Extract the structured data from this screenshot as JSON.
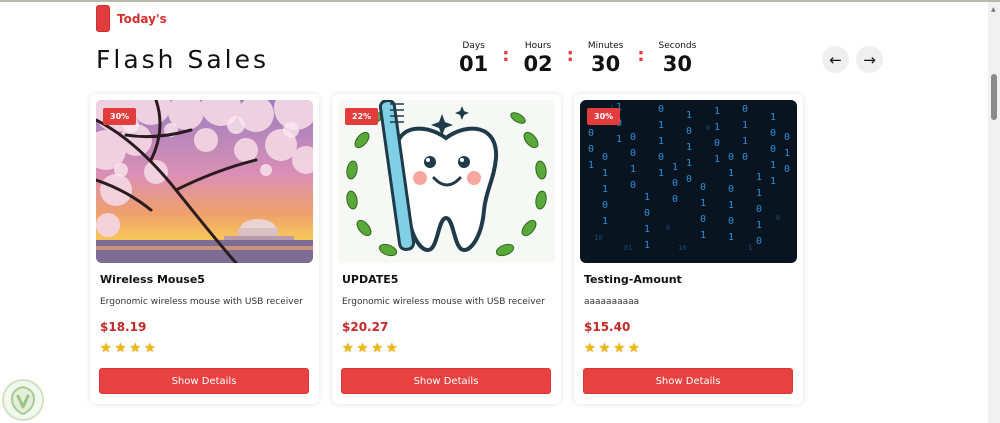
{
  "section": {
    "tag": "Today's",
    "title": "Flash Sales",
    "accent_color": "#e23c3c"
  },
  "countdown": {
    "days_label": "Days",
    "days": "01",
    "hours_label": "Hours",
    "hours": "02",
    "minutes_label": "Minutes",
    "minutes": "30",
    "seconds_label": "Seconds",
    "seconds": "30"
  },
  "nav": {
    "prev_icon": "arrow-left-icon",
    "prev_glyph": "←",
    "next_icon": "arrow-right-icon",
    "next_glyph": "→"
  },
  "products": [
    {
      "discount": "30%",
      "title": "Wireless Mouse5",
      "description": "Ergonomic wireless mouse with USB receiver",
      "price": "$18.19",
      "rating": 4,
      "button": "Show Details",
      "image": "cherry-blossom-sunset"
    },
    {
      "discount": "22%",
      "title": "UPDATE5",
      "description": "Ergonomic wireless mouse with USB receiver",
      "price": "$20.27",
      "rating": 4,
      "button": "Show Details",
      "image": "cartoon-tooth-toothbrush"
    },
    {
      "discount": "30%",
      "title": "Testing-Amount",
      "description": "aaaaaaaaaa",
      "price": "$15.40",
      "rating": 4,
      "button": "Show Details",
      "image": "binary-code-rain"
    }
  ],
  "colors": {
    "price": "#c62828",
    "button": "#e84141",
    "star": "#f2b705"
  }
}
